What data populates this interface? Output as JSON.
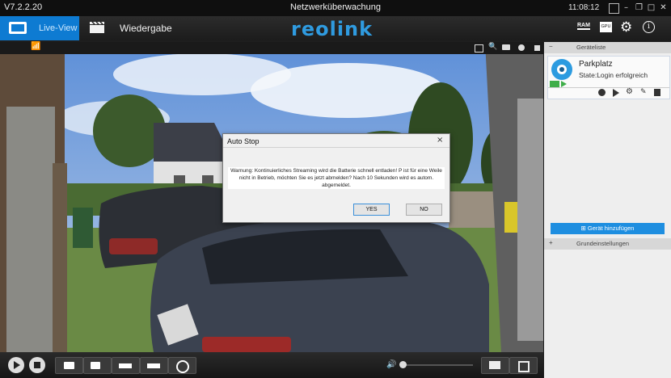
{
  "window": {
    "version": "V7.2.2.20",
    "title": "Netzwerküberwachung",
    "clock": "11:08:12"
  },
  "toolbar": {
    "live_tab": "Live-View",
    "playback_tab": "Wiedergabe",
    "logo": "reolink",
    "ram_label": "RAM",
    "gpu_label": "GPU"
  },
  "dialog": {
    "title": "Auto Stop",
    "message": "Warnung: Kontinuierliches Streaming wird die Batterie schnell entladen! P ist für eine Weile nicht in Betrieb, möchten Sie es jetzt abmelden? Nach 10 Sekunden wird es autom. abgemeldet.",
    "yes": "YES",
    "no": "NO",
    "close": "×"
  },
  "sidebar": {
    "device_list_title": "Geräteliste",
    "device_name": "Parkplatz",
    "device_state": "State:Login erfolgreich",
    "add_device": "Gerät hinzufügen",
    "settings_title": "Grundeinstellungen"
  },
  "colors": {
    "accent": "#0e7bd2",
    "add_button": "#1e8ee0"
  }
}
